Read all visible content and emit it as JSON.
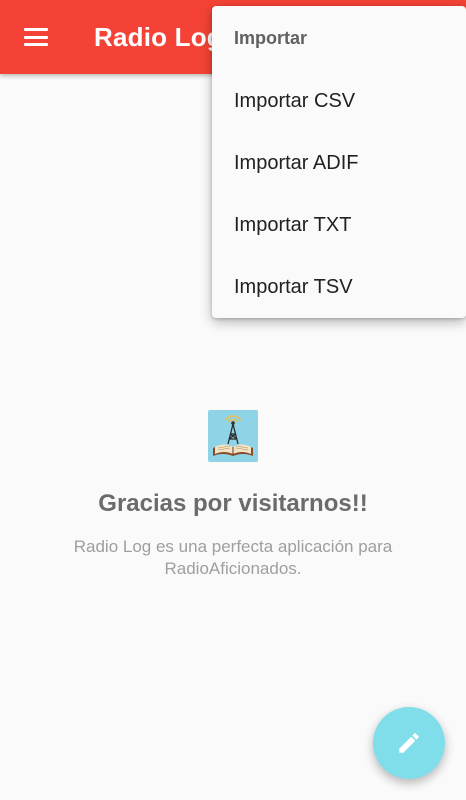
{
  "app_bar": {
    "title": "Radio Log",
    "menu_icon": "hamburger-menu-icon",
    "color": "#f44336"
  },
  "popup_menu": {
    "header": "Importar",
    "items": [
      {
        "label": "Importar CSV"
      },
      {
        "label": "Importar ADIF"
      },
      {
        "label": "Importar TXT"
      },
      {
        "label": "Importar TSV"
      }
    ]
  },
  "empty_state": {
    "logo_icon": "radio-tower-book-icon",
    "title": "Gracias por visitarnos!!",
    "description": "Radio Log es una perfecta aplicación para RadioAficionados."
  },
  "fab": {
    "icon": "pencil-icon",
    "color": "#80deea"
  }
}
